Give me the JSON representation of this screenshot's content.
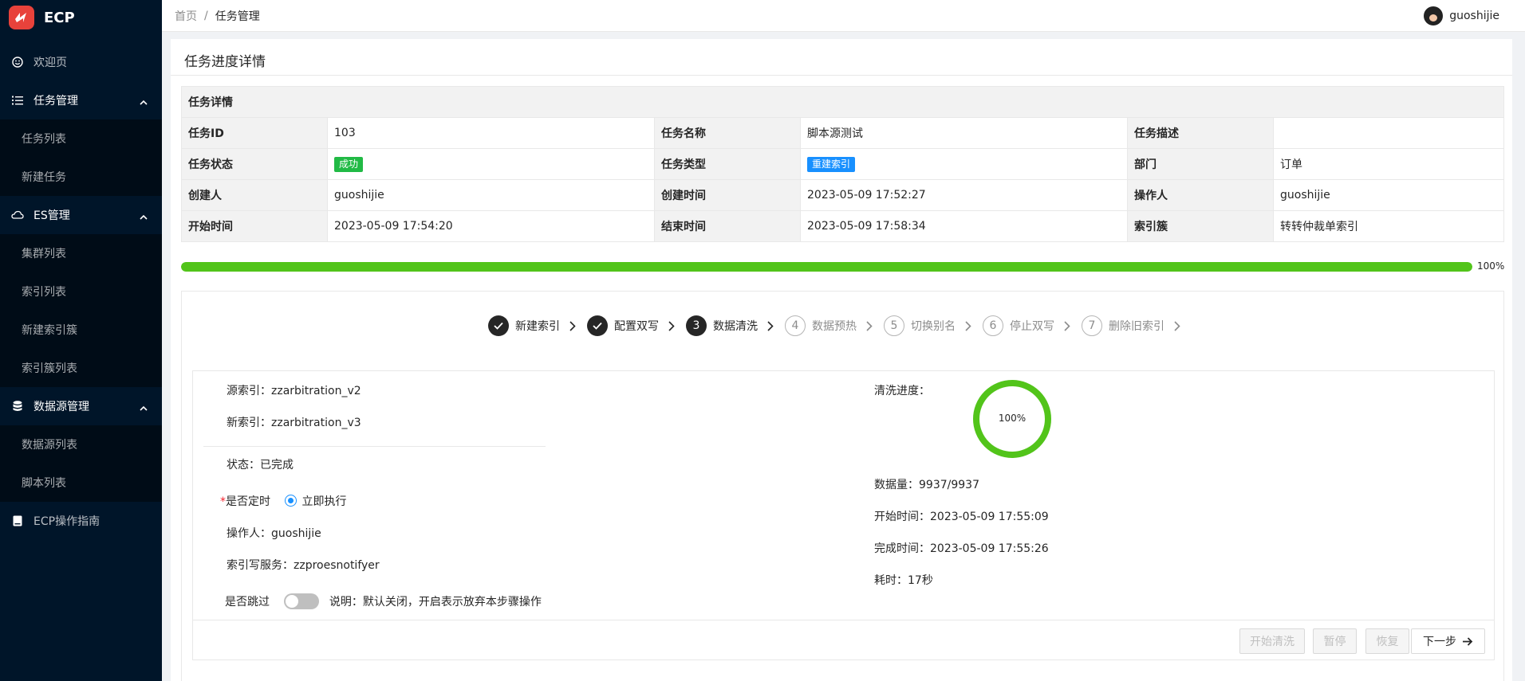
{
  "app": {
    "name": "ECP"
  },
  "sidebar": {
    "items": [
      {
        "label": "欢迎页"
      },
      {
        "label": "任务管理",
        "children": [
          "任务列表",
          "新建任务"
        ]
      },
      {
        "label": "ES管理",
        "children": [
          "集群列表",
          "索引列表",
          "新建索引簇",
          "索引簇列表"
        ]
      },
      {
        "label": "数据源管理",
        "children": [
          "数据源列表",
          "脚本列表"
        ]
      },
      {
        "label": "ECP操作指南"
      }
    ]
  },
  "header": {
    "breadcrumb": {
      "home": "首页",
      "sep": "/",
      "current": "任务管理"
    },
    "user": "guoshijie"
  },
  "page": {
    "title": "任务进度详情"
  },
  "details": {
    "heading": "任务详情",
    "rows": [
      [
        {
          "label": "任务ID",
          "value": "103"
        },
        {
          "label": "任务名称",
          "value": "脚本源测试"
        },
        {
          "label": "任务描述",
          "value": ""
        }
      ],
      [
        {
          "label": "任务状态",
          "tag": "成功"
        },
        {
          "label": "任务类型",
          "tag": "重建索引"
        },
        {
          "label": "部门",
          "value": "订单"
        }
      ],
      [
        {
          "label": "创建人",
          "value": "guoshijie"
        },
        {
          "label": "创建时间",
          "value": "2023-05-09 17:52:27"
        },
        {
          "label": "操作人",
          "value": "guoshijie"
        }
      ],
      [
        {
          "label": "开始时间",
          "value": "2023-05-09 17:54:20"
        },
        {
          "label": "结束时间",
          "value": "2023-05-09 17:58:34"
        },
        {
          "label": "索引簇",
          "value": "转转仲裁单索引"
        }
      ]
    ]
  },
  "progress": {
    "percent": 100,
    "text": "100%"
  },
  "steps": [
    {
      "num": "1",
      "label": "新建索引",
      "status": "done"
    },
    {
      "num": "2",
      "label": "配置双写",
      "status": "done"
    },
    {
      "num": "3",
      "label": "数据清洗",
      "status": "active"
    },
    {
      "num": "4",
      "label": "数据预热",
      "status": "wait"
    },
    {
      "num": "5",
      "label": "切换别名",
      "status": "wait"
    },
    {
      "num": "6",
      "label": "停止双写",
      "status": "wait"
    },
    {
      "num": "7",
      "label": "删除旧索引",
      "status": "wait"
    }
  ],
  "cleaning": {
    "source_label": "源索引：",
    "source_value": "zzarbitration_v2",
    "new_label": "新索引：",
    "new_value": "zzarbitration_v3",
    "status_label": "状态：",
    "status_value": "已完成",
    "scheduled_req": "*",
    "scheduled_label": "是否定时",
    "scheduled_option": "立即执行",
    "operator_label": "操作人：",
    "operator_value": "guoshijie",
    "service_label": "索引写服务：",
    "service_value": "zzproesnotifyer",
    "skip_label": "是否跳过",
    "skip_note": "说明：默认关闭，开启表示放弃本步骤操作",
    "progress_label": "清洗进度：",
    "progress_percent": 100,
    "progress_text": "100%",
    "count_label": "数据量：",
    "count_value": "9937/9937",
    "start_label": "开始时间：",
    "start_value": "2023-05-09 17:55:09",
    "finish_label": "完成时间：",
    "finish_value": "2023-05-09 17:55:26",
    "duration_label": "耗时：",
    "duration_value": "17秒"
  },
  "buttons": {
    "start": "开始清洗",
    "pause": "暂停",
    "resume": "恢复",
    "next": "下一步"
  },
  "colors": {
    "sidebar": "#001529",
    "success": "#52c41a",
    "tag_green": "#21ba45",
    "tag_blue": "#1890ff",
    "primary": "#1890ff"
  }
}
